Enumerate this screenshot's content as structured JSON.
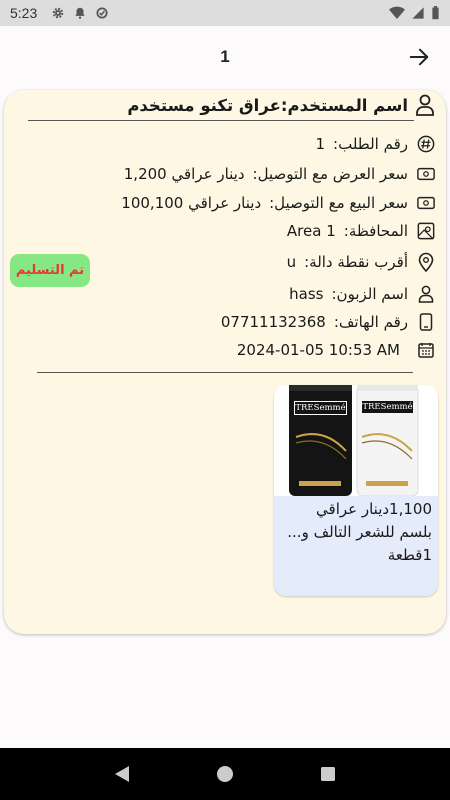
{
  "status_bar": {
    "time": "5:23"
  },
  "app_bar": {
    "title": "1"
  },
  "order": {
    "user_line": "اسم المستخدم:عراق تكنو مستخدم",
    "rows": [
      {
        "label": "رقم الطلب:",
        "value": "1"
      },
      {
        "label": "سعر العرض مع التوصيل:",
        "value": "1,200 دينار عراقي"
      },
      {
        "label": "سعر البيع مع التوصيل:",
        "value": "100,100 دينار عراقي"
      },
      {
        "label": "المحافظة:",
        "value": "Area 1"
      },
      {
        "label": "أقرب نقطة دالة:",
        "value": "u"
      },
      {
        "label": "اسم الزبون:",
        "value": "hass"
      },
      {
        "label": "رقم الهاتف:",
        "value": "07711132368"
      },
      {
        "label": "",
        "value": "2024-01-05 10:53 AM"
      }
    ],
    "status": "تم التسليم",
    "status_color": "#86e883"
  },
  "product": {
    "brand": "TRESemmé",
    "price": "1,100دينار عراقي",
    "name": "بلسم للشعر التالف و...",
    "quantity": "1قطعة"
  },
  "icons": {
    "user": "person-outline-icon",
    "order_number": "hash-icon",
    "offer_price": "money-icon",
    "sale_price": "money-icon",
    "province": "map-icon",
    "landmark": "location-pin-icon",
    "customer": "person-icon",
    "phone": "phone-icon",
    "date": "calendar-icon"
  }
}
